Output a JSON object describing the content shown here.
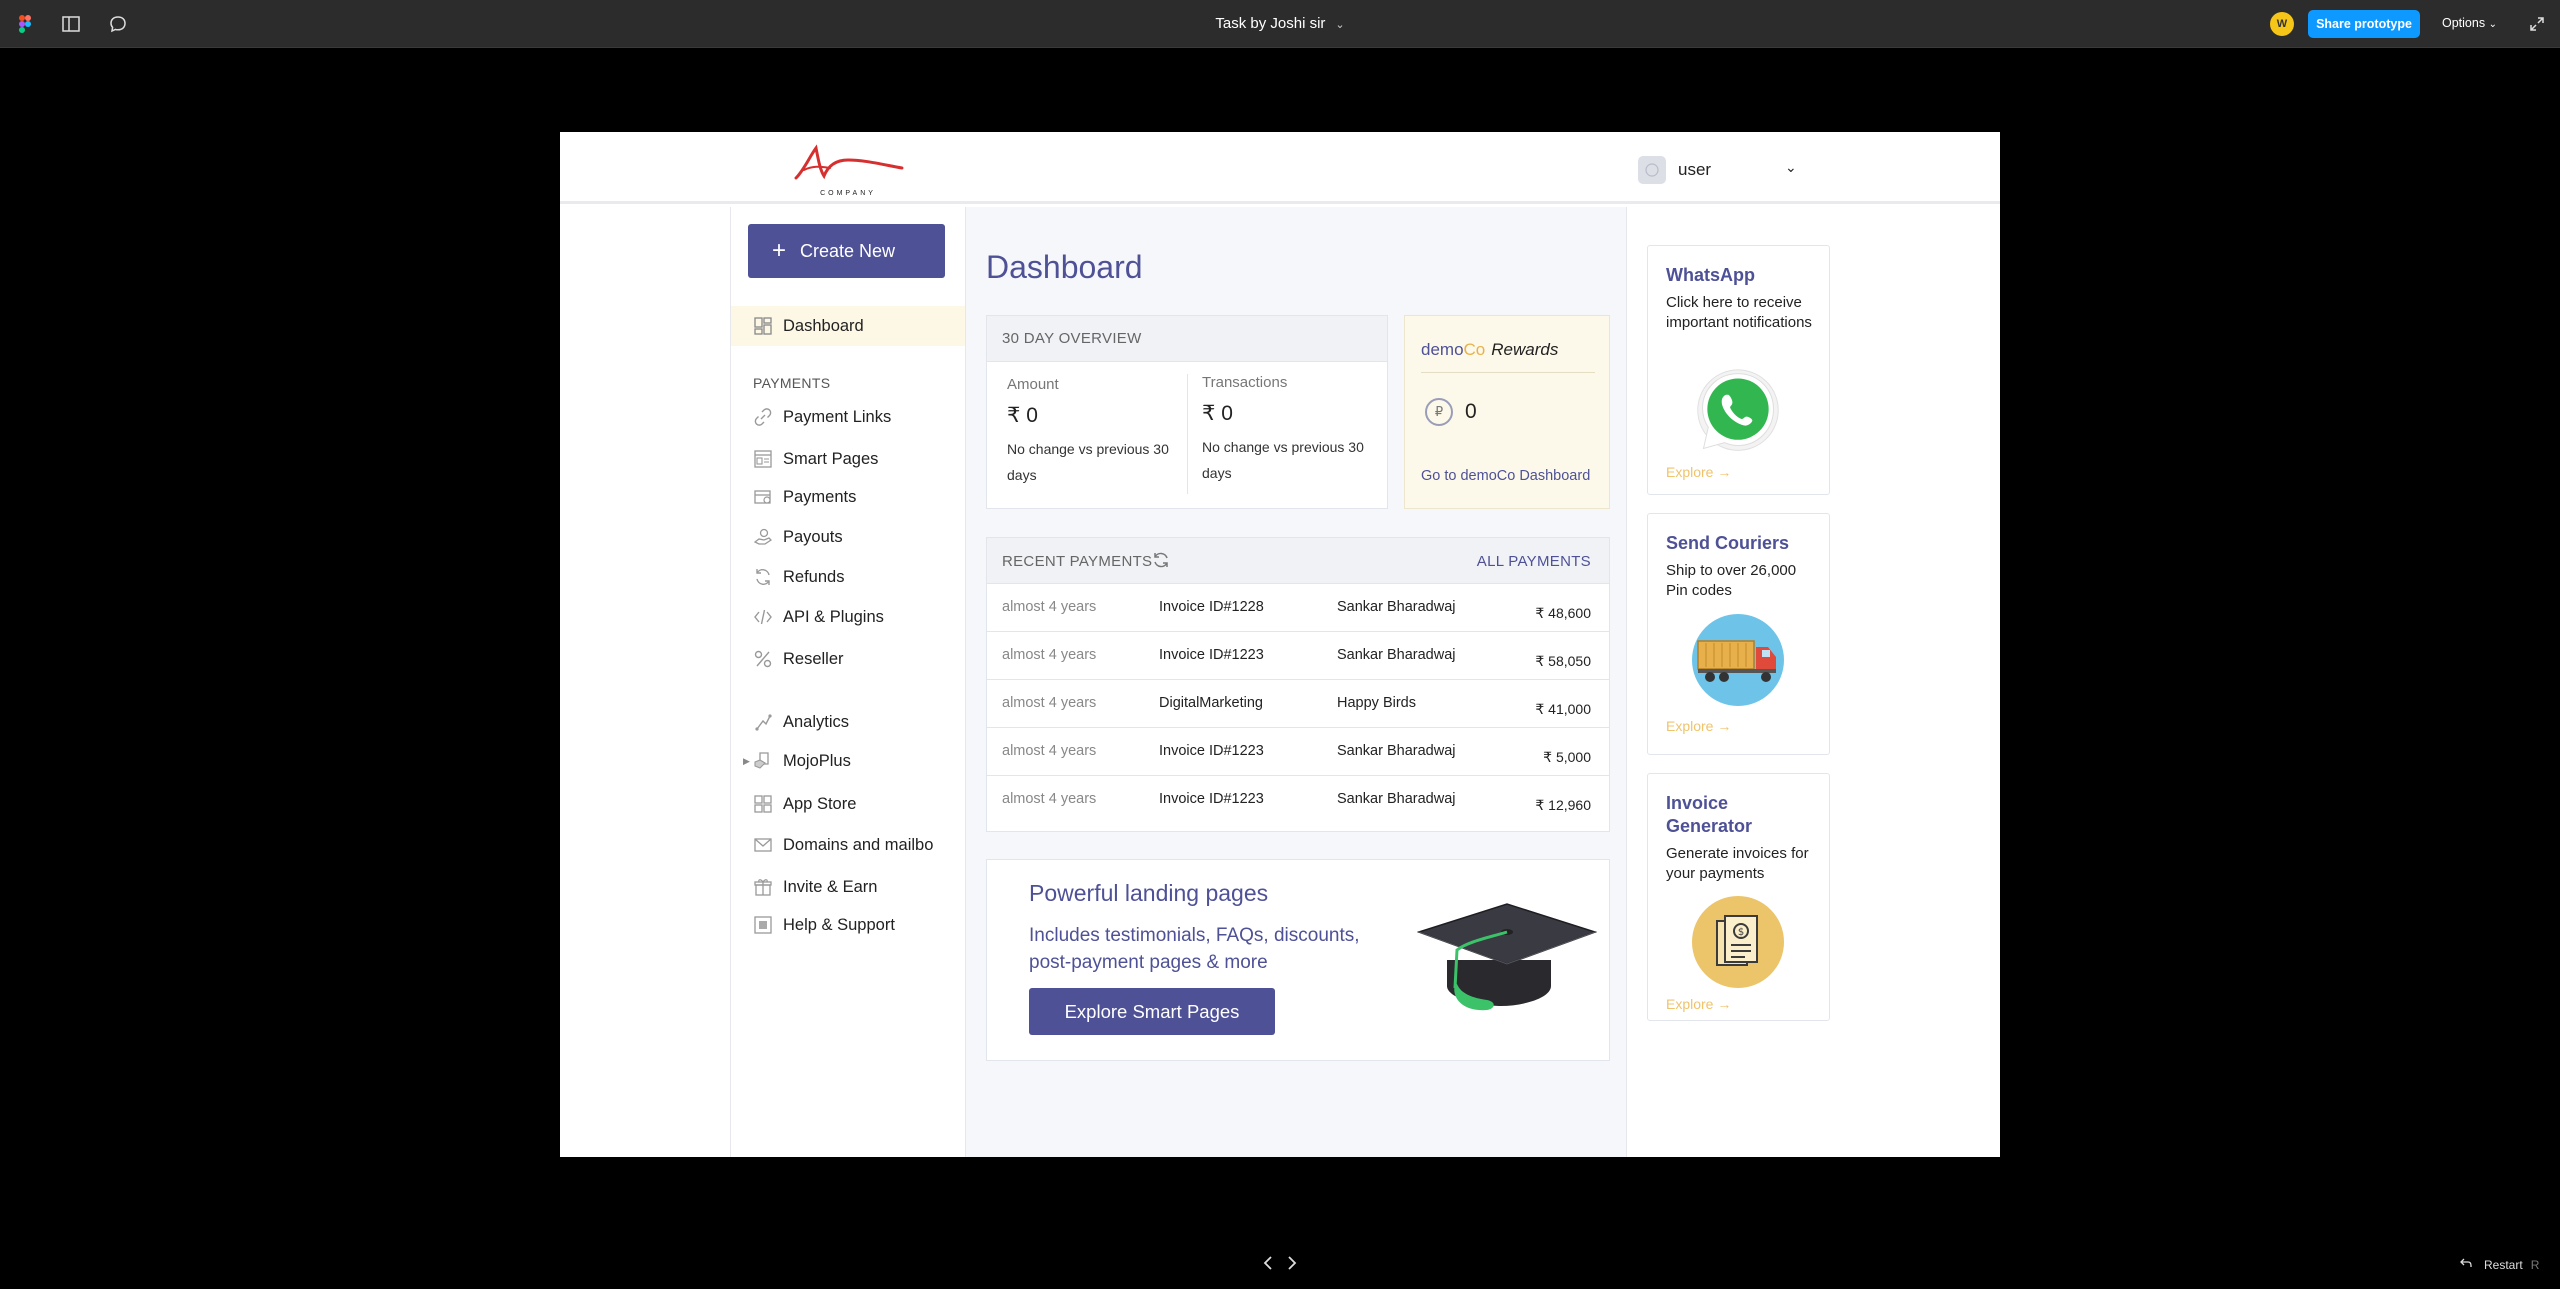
{
  "figma": {
    "file_title": "Task by Joshi sir",
    "avatar_initial": "W",
    "share_label": "Share prototype",
    "options_label": "Options",
    "restart_label": "Restart",
    "restart_key": "R"
  },
  "header": {
    "logo_text": "COMPANY",
    "user_name": "user"
  },
  "leftnav": {
    "create_label": "Create New",
    "dashboard_label": "Dashboard",
    "section_payments": "PAYMENTS",
    "items": [
      {
        "label": "Payment Links",
        "icon": "link-icon"
      },
      {
        "label": "Smart Pages",
        "icon": "smart-pages-icon"
      },
      {
        "label": "Payments",
        "icon": "payments-icon"
      },
      {
        "label": "Payouts",
        "icon": "payouts-icon"
      },
      {
        "label": "Refunds",
        "icon": "refund-icon"
      },
      {
        "label": "API & Plugins",
        "icon": "code-icon"
      },
      {
        "label": "Reseller",
        "icon": "percent-icon"
      },
      {
        "label": "Analytics",
        "icon": "analytics-icon"
      },
      {
        "label": "MojoPlus",
        "icon": "mojoplus-icon"
      },
      {
        "label": "App Store",
        "icon": "app-store-icon"
      },
      {
        "label": "Domains and mailbo",
        "icon": "mail-icon"
      },
      {
        "label": "Invite & Earn",
        "icon": "gift-icon"
      },
      {
        "label": "Help & Support",
        "icon": "help-icon"
      }
    ]
  },
  "main": {
    "title": "Dashboard",
    "overview": {
      "heading": "30 DAY OVERVIEW",
      "amount_label": "Amount",
      "amount_value": "₹ 0",
      "amount_note": "No change vs previous 30 days",
      "txn_label": "Transactions",
      "txn_value": "₹ 0",
      "txn_note": "No change vs previous 30 days"
    },
    "rewards": {
      "brand_part1": "demo",
      "brand_part2": "Co",
      "title_suffix": "Rewards",
      "coin_symbol": "₽",
      "points": "0",
      "link": "Go to demoCo Dashboard"
    },
    "recent_payments": {
      "heading": "RECENT PAYMENTS",
      "all_label": "ALL PAYMENTS",
      "rows": [
        {
          "time": "almost 4 years",
          "ref": "Invoice ID#1228",
          "customer": "Sankar Bharadwaj",
          "amount": "₹ 48,600"
        },
        {
          "time": "almost 4 years",
          "ref": "Invoice ID#1223",
          "customer": "Sankar Bharadwaj",
          "amount": "₹ 58,050"
        },
        {
          "time": "almost 4 years",
          "ref": "DigitalMarketing",
          "customer": "Happy Birds",
          "amount": "₹ 41,000"
        },
        {
          "time": "almost 4 years",
          "ref": "Invoice ID#1223",
          "customer": "Sankar Bharadwaj",
          "amount": "₹ 5,000"
        },
        {
          "time": "almost 4 years",
          "ref": "Invoice ID#1223",
          "customer": "Sankar Bharadwaj",
          "amount": "₹ 12,960"
        }
      ]
    },
    "promo": {
      "title": "Powerful landing pages",
      "desc": "Includes testimonials, FAQs, discounts, post-payment pages & more",
      "button": "Explore Smart Pages"
    }
  },
  "rightcol": {
    "cards": [
      {
        "title": "WhatsApp",
        "desc": "Click here to receive important notifications",
        "explore": "Explore →",
        "icon": "whatsapp-icon"
      },
      {
        "title": "Send Couriers",
        "desc": "Ship to over 26,000 Pin codes",
        "explore": "Explore →",
        "icon": "truck-icon"
      },
      {
        "title": "Invoice Generator",
        "desc": "Generate invoices for your payments",
        "explore": "Explore →",
        "icon": "invoice-icon"
      }
    ]
  },
  "colors": {
    "accent": "#4e5196",
    "figma_blue": "#0d99ff",
    "explore": "#f0c36b",
    "active_nav": "#fdf7e6"
  }
}
